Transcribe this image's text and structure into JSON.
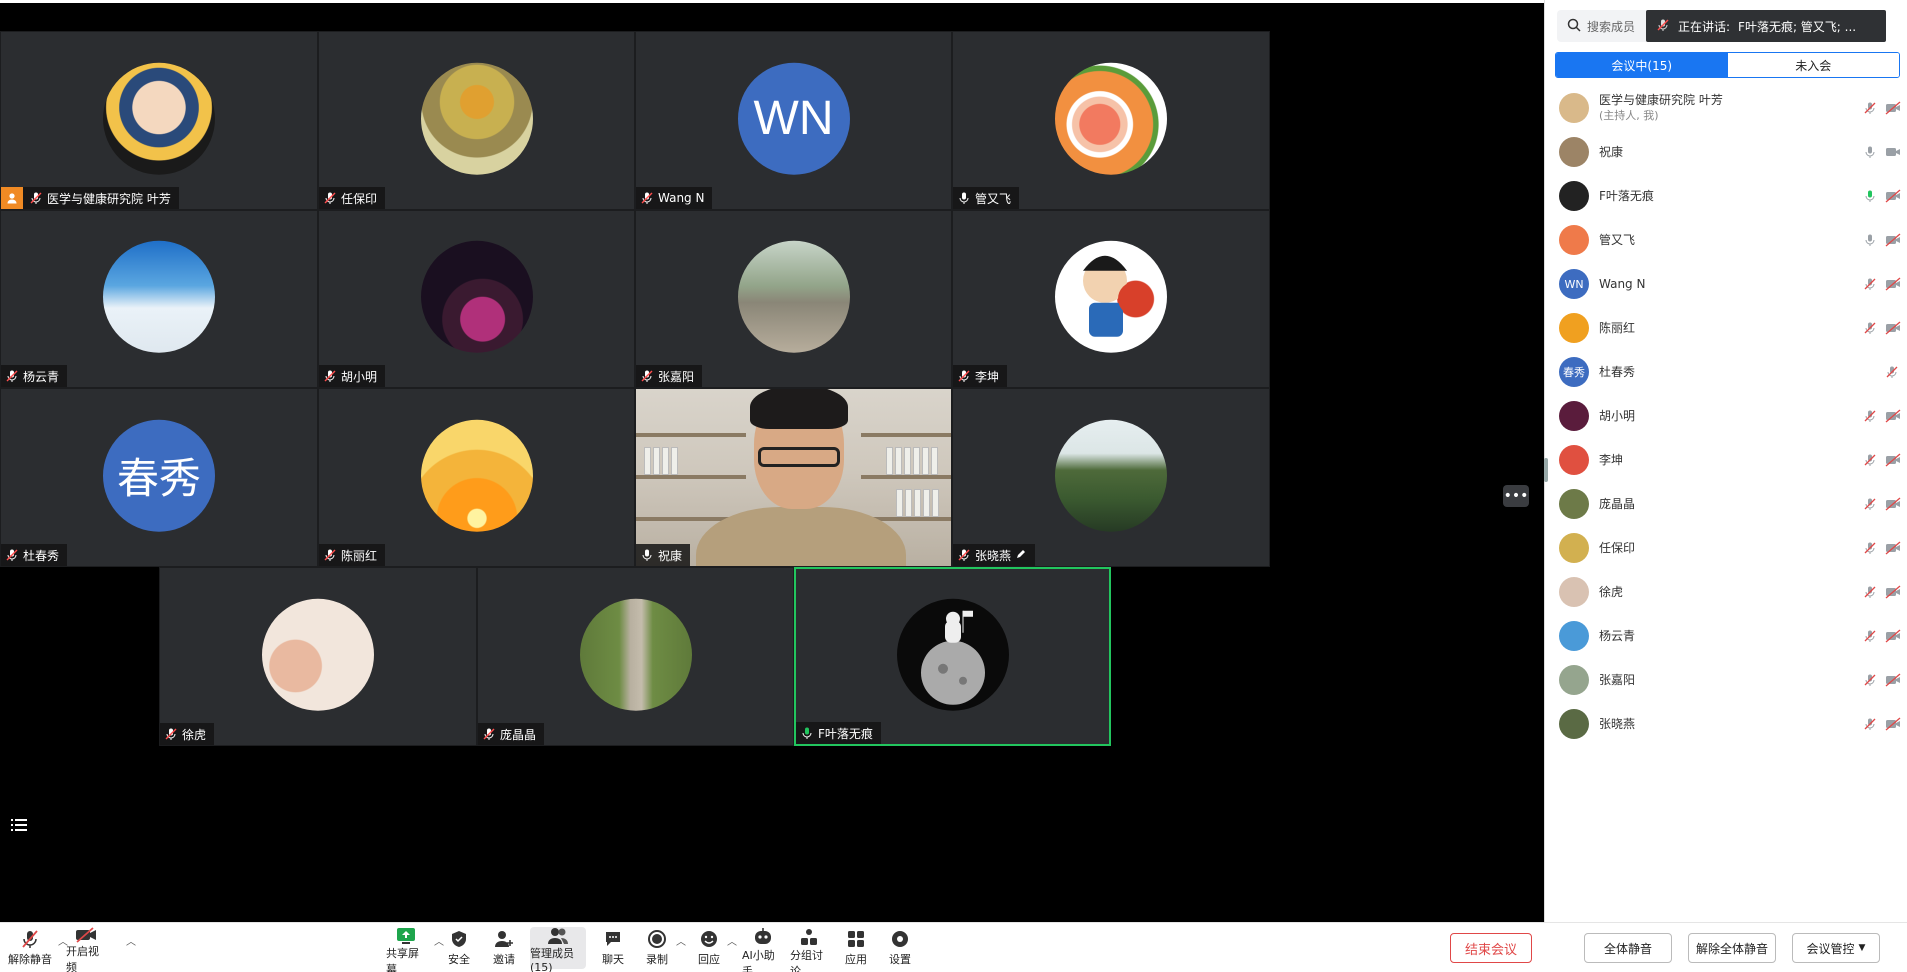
{
  "speaking_banner": {
    "label": "正在讲话:",
    "names": "F叶落无痕; 管又飞; ..."
  },
  "search": {
    "placeholder": "搜索成员"
  },
  "tabs": {
    "in_meeting": "会议中(15)",
    "not_joined": "未入会"
  },
  "tiles": [
    {
      "name": "医学与健康研究院 叶芳",
      "host": true,
      "avatar": "girl-pearl-earring-avatar"
    },
    {
      "name": "任保印",
      "avatar": "sunflowers-avatar"
    },
    {
      "name": "Wang N",
      "avatar_text": "WN"
    },
    {
      "name": "管又飞",
      "avatar": "grapefruit-avatar"
    },
    {
      "name": "杨云青",
      "avatar": "sky-clouds-avatar"
    },
    {
      "name": "胡小明",
      "avatar": "couple-city-night-avatar"
    },
    {
      "name": "张嘉阳",
      "avatar": "railway-walker-avatar"
    },
    {
      "name": "李坤",
      "avatar": "basketball-cartoon-avatar"
    },
    {
      "name": "杜春秀",
      "avatar_text": "春秀"
    },
    {
      "name": "陈丽红",
      "avatar": "sunset-poem-avatar"
    },
    {
      "name": "祝康",
      "camera": true
    },
    {
      "name": "张晓燕",
      "avatar": "pond-trees-avatar"
    },
    {
      "name": "徐虎",
      "avatar": "cartoon-jiayou-avatar"
    },
    {
      "name": "庞晶晶",
      "avatar": "tree-path-avatar"
    },
    {
      "name": "F叶落无痕",
      "avatar": "astronaut-moon-avatar",
      "speaking": true
    }
  ],
  "members": [
    {
      "name": "医学与健康研究院 叶芳",
      "sub": "(主持人, 我)",
      "mic": "muted",
      "cam": "off",
      "avatar_color": "#d9b98a"
    },
    {
      "name": "祝康",
      "mic": "on",
      "cam": "on",
      "avatar_color": "#9c8466"
    },
    {
      "name": "F叶落无痕",
      "mic": "speaking",
      "cam": "off",
      "avatar_color": "#222222"
    },
    {
      "name": "管又飞",
      "mic": "on",
      "cam": "off",
      "avatar_color": "#ef7a4a"
    },
    {
      "name": "Wang N",
      "avatar_text": "WN",
      "mic": "muted",
      "cam": "off",
      "avatar_color": "#3d6cc0"
    },
    {
      "name": "陈丽红",
      "mic": "muted",
      "cam": "off",
      "avatar_color": "#f0a020"
    },
    {
      "name": "杜春秀",
      "avatar_text": "春秀",
      "mic": "muted",
      "cam": "none",
      "avatar_color": "#3d6cc0"
    },
    {
      "name": "胡小明",
      "mic": "muted",
      "cam": "off",
      "avatar_color": "#5a1c3c"
    },
    {
      "name": "李坤",
      "mic": "muted",
      "cam": "off",
      "avatar_color": "#e05040"
    },
    {
      "name": "庞晶晶",
      "mic": "muted",
      "cam": "off",
      "avatar_color": "#6d7a48"
    },
    {
      "name": "任保印",
      "mic": "muted",
      "cam": "off",
      "avatar_color": "#d2b050"
    },
    {
      "name": "徐虎",
      "mic": "muted",
      "cam": "off",
      "avatar_color": "#d9c2b2"
    },
    {
      "name": "杨云青",
      "mic": "muted",
      "cam": "off",
      "avatar_color": "#4a9ad8"
    },
    {
      "name": "张嘉阳",
      "mic": "muted",
      "cam": "off",
      "avatar_color": "#95a58e"
    },
    {
      "name": "张晓燕",
      "mic": "muted",
      "cam": "off",
      "avatar_color": "#5a6a44"
    }
  ],
  "toolbar": {
    "unmute": "解除静音",
    "start_video": "开启视频",
    "share_screen": "共享屏幕",
    "security": "安全",
    "invite": "邀请",
    "manage_members": "管理成员(15)",
    "chat": "聊天",
    "record": "录制",
    "react": "回应",
    "ai_assistant": "AI小助手",
    "breakout": "分组讨论",
    "apps": "应用",
    "settings": "设置",
    "end_meeting": "结束会议"
  },
  "panel_buttons": {
    "mute_all": "全体静音",
    "unmute_all": "解除全体静音",
    "meeting_control": "会议管控"
  },
  "colors": {
    "accent": "#1976f2",
    "speaking": "#22c55e",
    "danger": "#e04848",
    "host": "#f08a24"
  }
}
